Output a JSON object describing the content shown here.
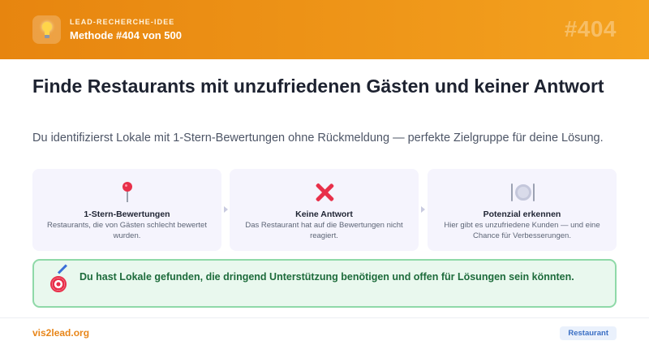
{
  "header": {
    "icon": "lightbulb-icon",
    "eyebrow": "LEAD-RECHERCHE-IDEE",
    "method": "Methode #404 von 500",
    "number": "#404",
    "gradient": [
      "#e7850f",
      "#f4a21f"
    ]
  },
  "main": {
    "title": "Finde Restaurants mit unzufriedenen Gästen und keiner Antwort",
    "subtitle": "Du identifizierst Lokale mit 1-Stern-Bewertungen ohne Rückmeldung — perfekte Zielgruppe für deine Lösung."
  },
  "steps": [
    {
      "icon": "pushpin-icon",
      "title": "1-Stern-Bewertungen",
      "description": "Restaurants, die von Gästen schlecht bewertet wurden."
    },
    {
      "icon": "cross-mark-icon",
      "title": "Keine Antwort",
      "description": "Das Restaurant hat auf die Bewertungen nicht reagiert."
    },
    {
      "icon": "plate-cutlery-icon",
      "title": "Potenzial erkennen",
      "description": "Hier gibt es unzufriedene Kunden — und eine Chance für Verbesserungen."
    }
  ],
  "result": {
    "icon": "target-icon",
    "text": "Du hast Lokale gefunden, die dringend Unterstützung benötigen und offen für Lösungen sein könnten.",
    "background": "#e9f8ee",
    "border": "#8fd9a8"
  },
  "footer": {
    "brand": "vis2lead.org",
    "tag": "Restaurant",
    "brand_color": "#e8861a"
  }
}
